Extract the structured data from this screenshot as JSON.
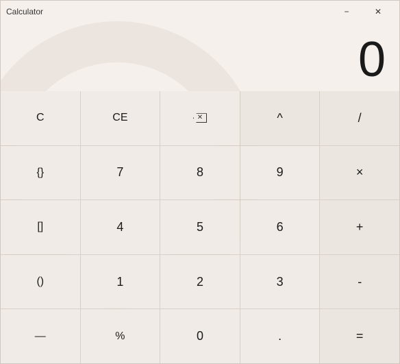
{
  "window": {
    "title": "Calculator",
    "minimize_label": "−",
    "close_label": "✕"
  },
  "display": {
    "value": "0"
  },
  "buttons": [
    {
      "id": "clear",
      "label": "C",
      "type": "special"
    },
    {
      "id": "clear-entry",
      "label": "CE",
      "type": "special"
    },
    {
      "id": "backspace",
      "label": "⌫",
      "type": "backspace"
    },
    {
      "id": "power",
      "label": "^",
      "type": "operator"
    },
    {
      "id": "divide",
      "label": "/",
      "type": "operator"
    },
    {
      "id": "curly-braces",
      "label": "{}",
      "type": "special"
    },
    {
      "id": "seven",
      "label": "7",
      "type": "number"
    },
    {
      "id": "eight",
      "label": "8",
      "type": "number"
    },
    {
      "id": "nine",
      "label": "9",
      "type": "number"
    },
    {
      "id": "multiply",
      "label": "×",
      "type": "operator"
    },
    {
      "id": "square-brackets",
      "label": "[]",
      "type": "special"
    },
    {
      "id": "four",
      "label": "4",
      "type": "number"
    },
    {
      "id": "five",
      "label": "5",
      "type": "number"
    },
    {
      "id": "six",
      "label": "6",
      "type": "number"
    },
    {
      "id": "add",
      "label": "+",
      "type": "operator"
    },
    {
      "id": "parentheses",
      "label": "()",
      "type": "special"
    },
    {
      "id": "one",
      "label": "1",
      "type": "number"
    },
    {
      "id": "two",
      "label": "2",
      "type": "number"
    },
    {
      "id": "three",
      "label": "3",
      "type": "number"
    },
    {
      "id": "subtract",
      "label": "-",
      "type": "operator"
    },
    {
      "id": "negate",
      "label": "—",
      "type": "special"
    },
    {
      "id": "percent",
      "label": "%",
      "type": "special"
    },
    {
      "id": "zero",
      "label": "0",
      "type": "number"
    },
    {
      "id": "decimal",
      "label": ".",
      "type": "number"
    },
    {
      "id": "equals",
      "label": "=",
      "type": "operator"
    }
  ]
}
